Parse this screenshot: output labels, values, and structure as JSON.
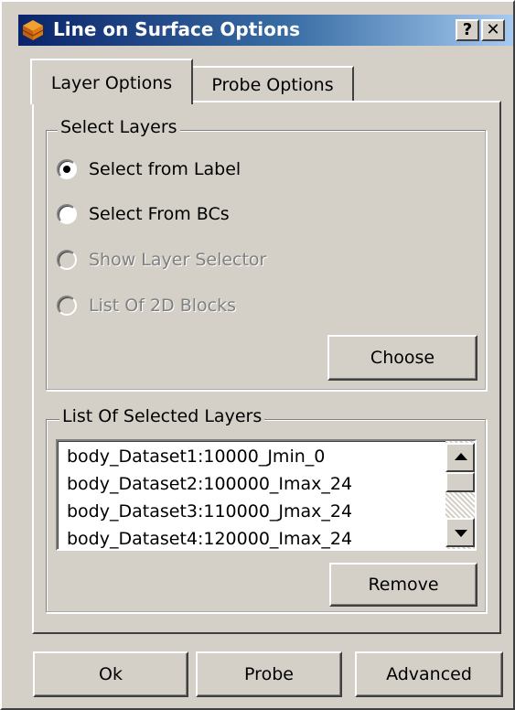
{
  "window": {
    "title": "Line on Surface Options",
    "help_label": "?",
    "close_label": "✕"
  },
  "tabs": [
    {
      "label": "Layer Options",
      "active": true
    },
    {
      "label": "Probe Options",
      "active": false
    }
  ],
  "select_layers": {
    "legend": "Select Layers",
    "options": [
      {
        "label": "Select from Label",
        "checked": true,
        "enabled": true
      },
      {
        "label": "Select From BCs",
        "checked": false,
        "enabled": true
      },
      {
        "label": "Show Layer Selector",
        "checked": false,
        "enabled": false
      },
      {
        "label": "List Of 2D Blocks",
        "checked": false,
        "enabled": false
      }
    ],
    "choose_label": "Choose"
  },
  "selected_layers": {
    "legend": "List Of Selected Layers",
    "items": [
      "body_Dataset1:10000_Jmin_0",
      "body_Dataset2:100000_Imax_24",
      "body_Dataset3:110000_Jmax_24",
      "body_Dataset4:120000_Imax_24"
    ],
    "remove_label": "Remove"
  },
  "footer": {
    "ok_label": "Ok",
    "probe_label": "Probe",
    "advanced_label": "Advanced"
  },
  "colors": {
    "face": "#d4d0c8",
    "title_start": "#0a246a",
    "title_end": "#a6caf0",
    "icon": "#e07a10"
  },
  "icons": [
    "app-icon",
    "help-icon",
    "close-icon",
    "scroll-up-icon",
    "scroll-down-icon"
  ]
}
